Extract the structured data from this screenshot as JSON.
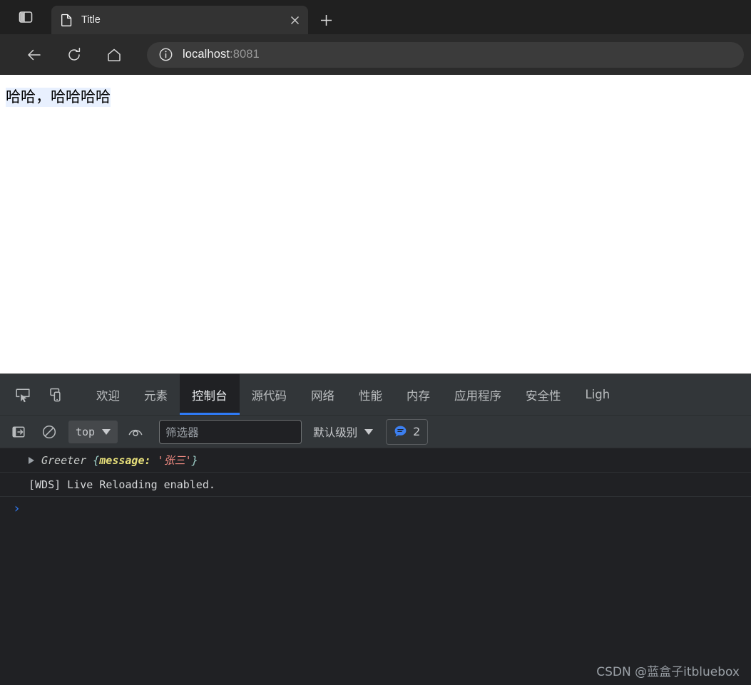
{
  "browser": {
    "sidebar_toggle_icon": "sidebar-panel-icon",
    "tab": {
      "favicon": "document-icon",
      "title": "Title",
      "close_icon": "close-icon"
    },
    "new_tab_icon": "plus-icon",
    "toolbar": {
      "back_icon": "back-arrow-icon",
      "reload_icon": "reload-icon",
      "home_icon": "home-icon"
    },
    "omnibox": {
      "info_icon": "info-circle-icon",
      "host": "localhost",
      "port": ":8081",
      "full_url": "localhost:8081"
    }
  },
  "page": {
    "text": "哈哈，哈哈哈哈"
  },
  "devtools": {
    "inspect_icon": "inspect-element-icon",
    "device_icon": "device-toolbar-icon",
    "tabs": [
      {
        "label": "欢迎",
        "active": false
      },
      {
        "label": "元素",
        "active": false
      },
      {
        "label": "控制台",
        "active": true
      },
      {
        "label": "源代码",
        "active": false
      },
      {
        "label": "网络",
        "active": false
      },
      {
        "label": "性能",
        "active": false
      },
      {
        "label": "内存",
        "active": false
      },
      {
        "label": "应用程序",
        "active": false
      },
      {
        "label": "安全性",
        "active": false
      },
      {
        "label": "Ligh",
        "active": false
      }
    ],
    "console_toolbar": {
      "sidebar_icon": "console-sidebar-icon",
      "clear_icon": "clear-console-icon",
      "context_label": "top",
      "live_expression_icon": "eye-icon",
      "filter_placeholder": "筛选器",
      "filter_value": "",
      "level_label": "默认级别",
      "message_badge_icon": "speech-bubble-icon",
      "message_count": "2"
    },
    "console_messages": [
      {
        "type": "object",
        "expandable": true,
        "constructor": "Greeter",
        "open_brace": " {",
        "key": "message:",
        "value": " '张三'",
        "close_brace": "}"
      },
      {
        "type": "text",
        "expandable": false,
        "text": "[WDS] Live Reloading enabled."
      }
    ],
    "prompt_symbol": "›"
  },
  "watermark": "CSDN @蓝盒子itbluebox"
}
